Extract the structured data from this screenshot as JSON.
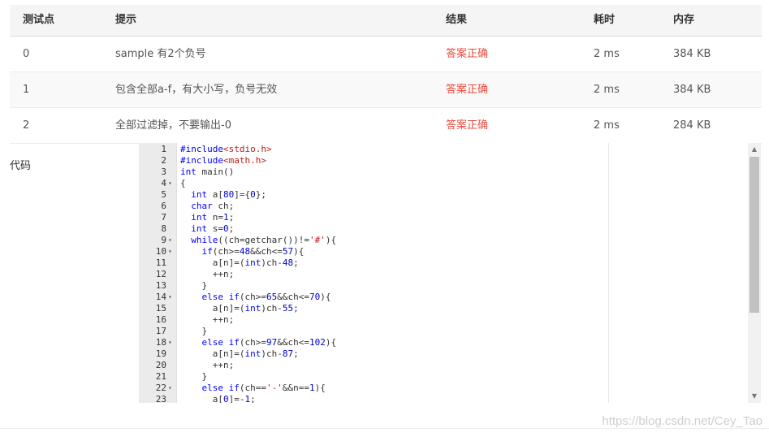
{
  "table": {
    "headers": {
      "case": "测试点",
      "hint": "提示",
      "result": "结果",
      "time": "耗时",
      "memory": "内存"
    },
    "rows": [
      {
        "case": "0",
        "hint": "sample 有2个负号",
        "result": "答案正确",
        "time": "2 ms",
        "memory": "384 KB"
      },
      {
        "case": "1",
        "hint": "包含全部a-f，有大小写，负号无效",
        "result": "答案正确",
        "time": "2 ms",
        "memory": "384 KB"
      },
      {
        "case": "2",
        "hint": "全部过滤掉，不要输出-0",
        "result": "答案正确",
        "time": "2 ms",
        "memory": "284 KB"
      }
    ]
  },
  "code_label": "代码",
  "code_lines": [
    {
      "n": "1",
      "fold": false,
      "text": "#include<stdio.h>"
    },
    {
      "n": "2",
      "fold": false,
      "text": "#include<math.h>"
    },
    {
      "n": "3",
      "fold": false,
      "text": "int main()"
    },
    {
      "n": "4",
      "fold": true,
      "text": "{"
    },
    {
      "n": "5",
      "fold": false,
      "text": "  int a[80]={0};"
    },
    {
      "n": "6",
      "fold": false,
      "text": "  char ch;"
    },
    {
      "n": "7",
      "fold": false,
      "text": "  int n=1;"
    },
    {
      "n": "8",
      "fold": false,
      "text": "  int s=0;"
    },
    {
      "n": "9",
      "fold": true,
      "text": "  while((ch=getchar())!='#'){"
    },
    {
      "n": "10",
      "fold": true,
      "text": "    if(ch>=48&&ch<=57){"
    },
    {
      "n": "11",
      "fold": false,
      "text": "      a[n]=(int)ch-48;"
    },
    {
      "n": "12",
      "fold": false,
      "text": "      ++n;"
    },
    {
      "n": "13",
      "fold": false,
      "text": "    }"
    },
    {
      "n": "14",
      "fold": true,
      "text": "    else if(ch>=65&&ch<=70){"
    },
    {
      "n": "15",
      "fold": false,
      "text": "      a[n]=(int)ch-55;"
    },
    {
      "n": "16",
      "fold": false,
      "text": "      ++n;"
    },
    {
      "n": "17",
      "fold": false,
      "text": "    }"
    },
    {
      "n": "18",
      "fold": true,
      "text": "    else if(ch>=97&&ch<=102){"
    },
    {
      "n": "19",
      "fold": false,
      "text": "      a[n]=(int)ch-87;"
    },
    {
      "n": "20",
      "fold": false,
      "text": "      ++n;"
    },
    {
      "n": "21",
      "fold": false,
      "text": "    }"
    },
    {
      "n": "22",
      "fold": true,
      "text": "    else if(ch=='-'&&n==1){"
    },
    {
      "n": "23",
      "fold": false,
      "text": "      a[0]=-1;"
    }
  ],
  "fold_glyph": "▾",
  "scroll_up_glyph": "▲",
  "scroll_down_glyph": "▼",
  "watermark": "https://blog.csdn.net/Cey_Tao",
  "colors": {
    "accepted": "#e74c3c",
    "keyword": "#0000ff",
    "string": "#c41a16"
  }
}
